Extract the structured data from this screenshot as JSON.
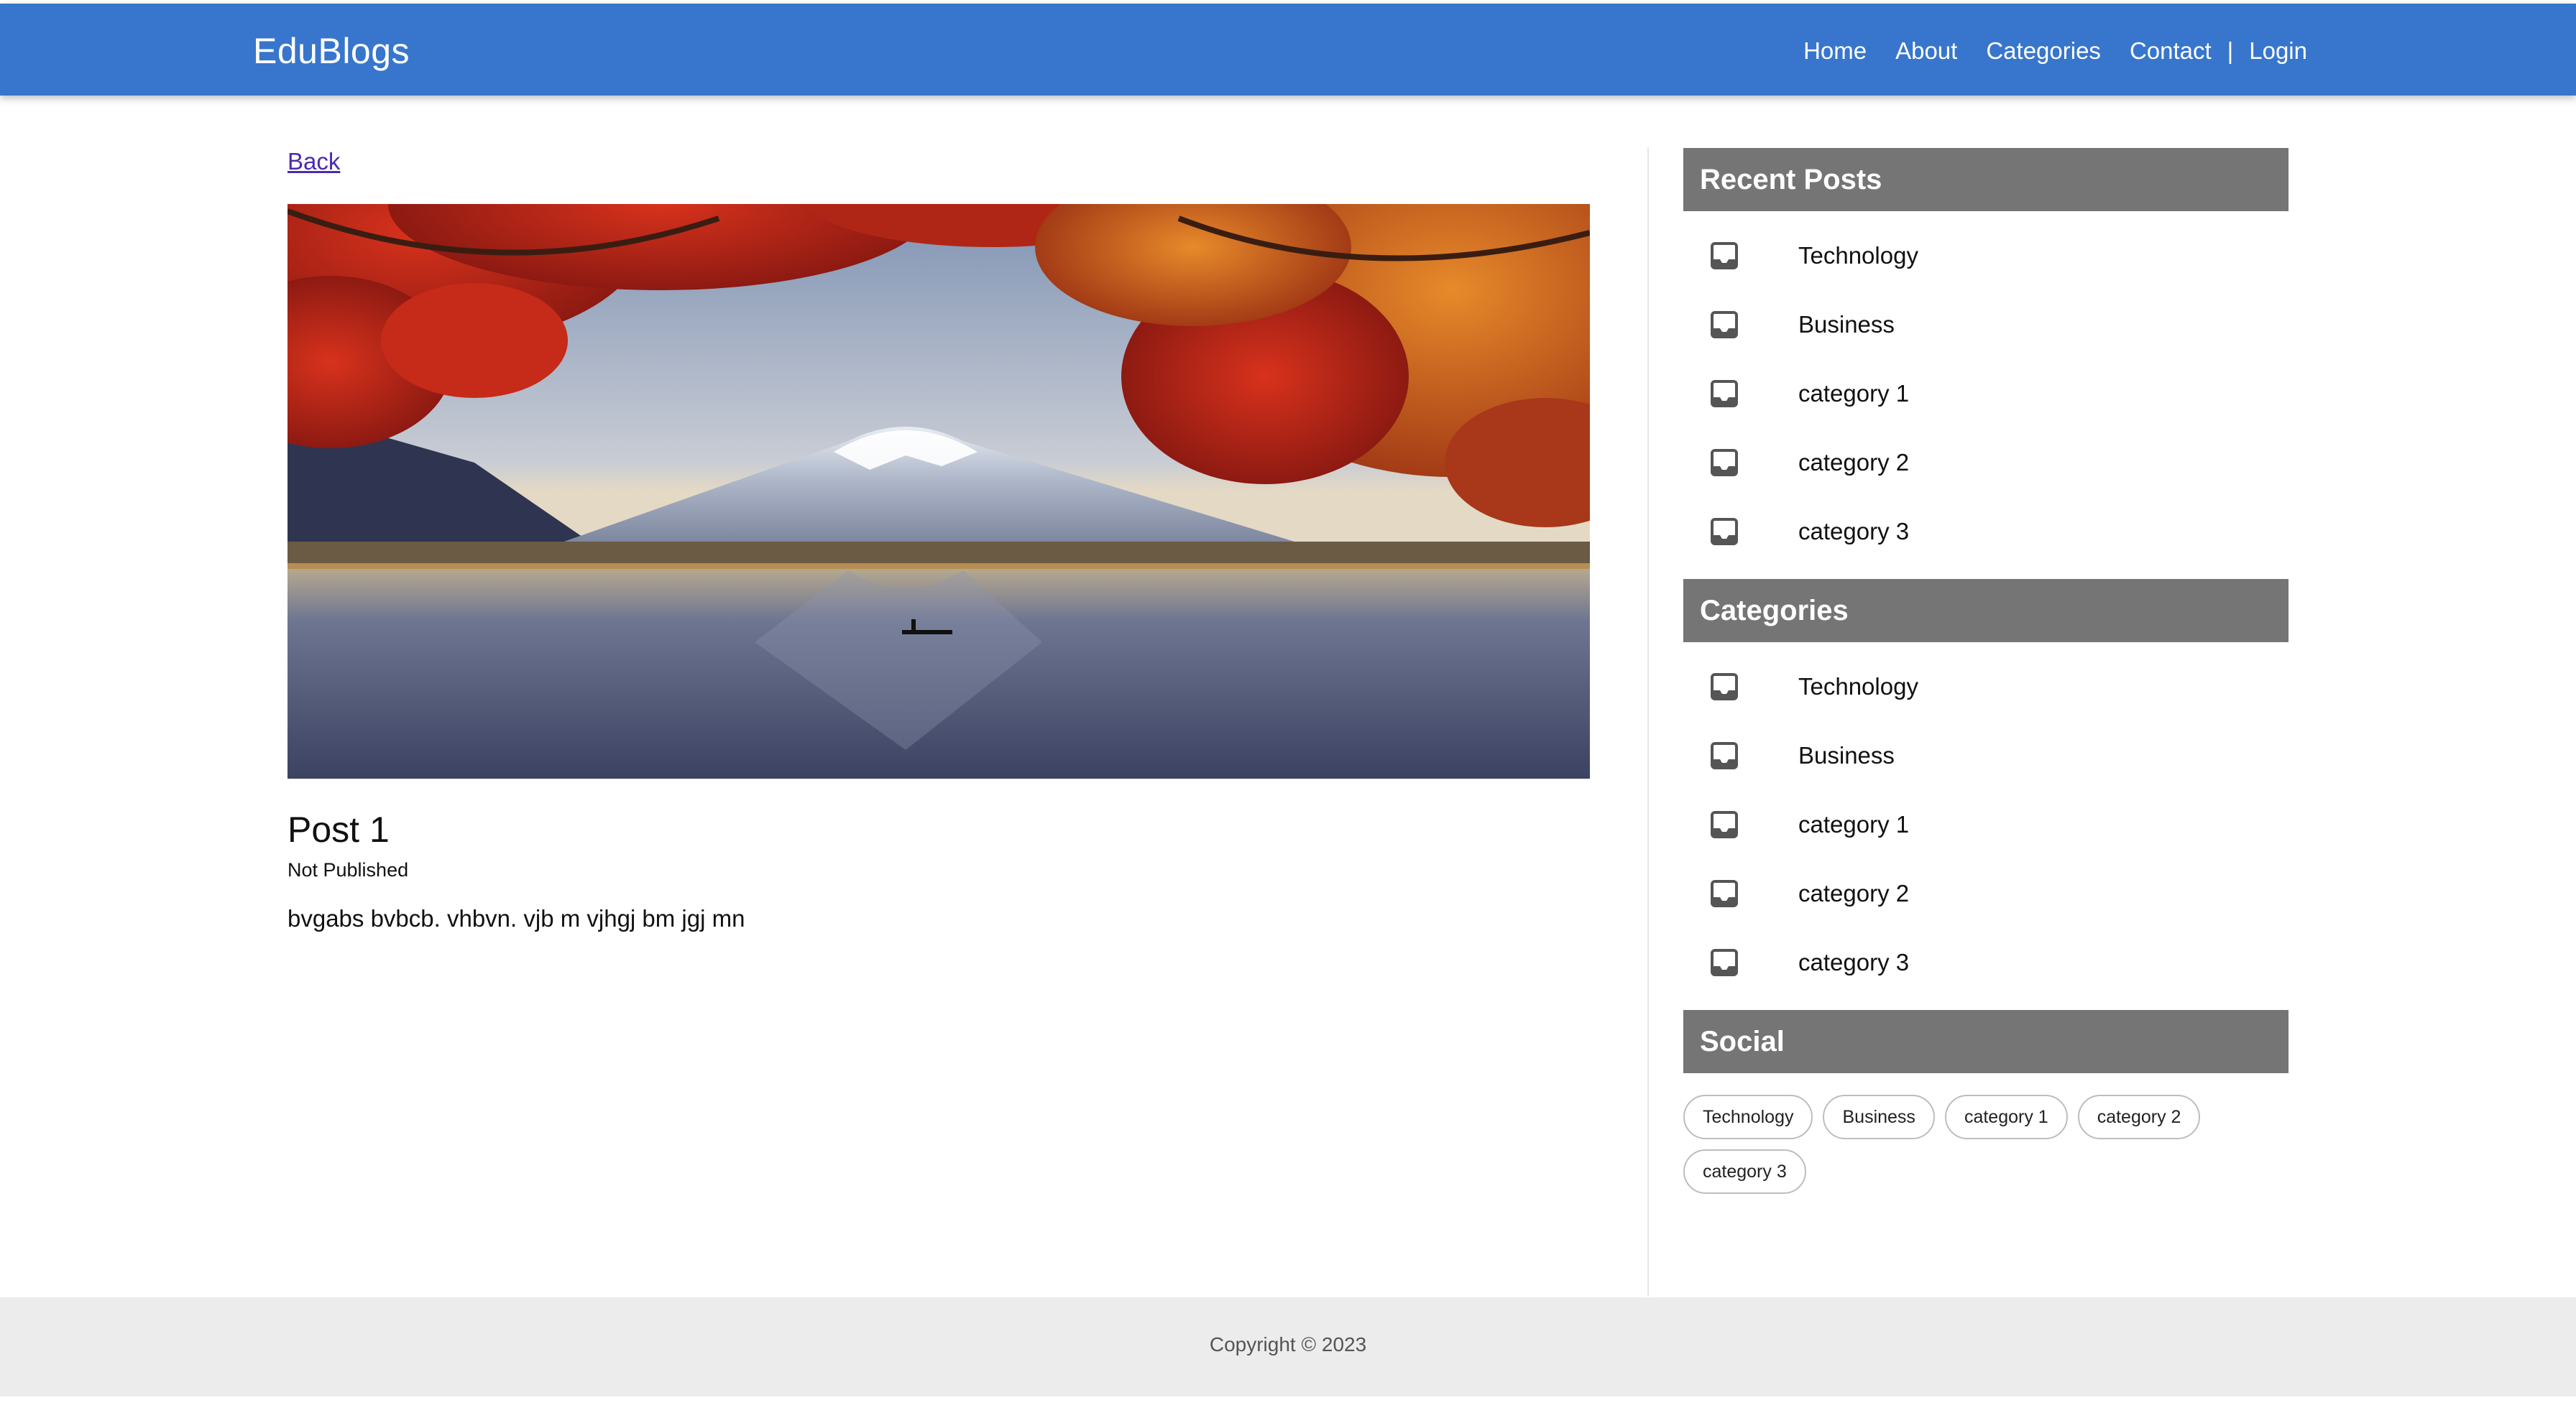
{
  "header": {
    "brand": "EduBlogs",
    "nav": {
      "home": "Home",
      "about": "About",
      "categories": "Categories",
      "contact": "Contact",
      "separator": "|",
      "login": "Login"
    }
  },
  "main": {
    "back": "Back",
    "image_icon": "landscape-photo-mount-fuji",
    "post": {
      "title": "Post 1",
      "status": "Not Published",
      "body": "bvgabs bvbcb. vhbvn. vjb m vjhgj bm jgj mn"
    }
  },
  "sidebar": {
    "recent_posts": {
      "title": "Recent Posts",
      "items": [
        "Technology",
        "Business",
        "category 1",
        "category 2",
        "category 3"
      ]
    },
    "categories": {
      "title": "Categories",
      "items": [
        "Technology",
        "Business",
        "category 1",
        "category 2",
        "category 3"
      ]
    },
    "social": {
      "title": "Social",
      "tags": [
        "Technology",
        "Business",
        "category 1",
        "category 2",
        "category 3"
      ]
    },
    "item_icon": "inbox-icon"
  },
  "footer": {
    "copyright": "Copyright © 2023"
  },
  "colors": {
    "header_bg": "#3776cc",
    "sidebar_header_bg": "#757575",
    "link": "#4a2bb0",
    "footer_bg": "#ececec"
  }
}
